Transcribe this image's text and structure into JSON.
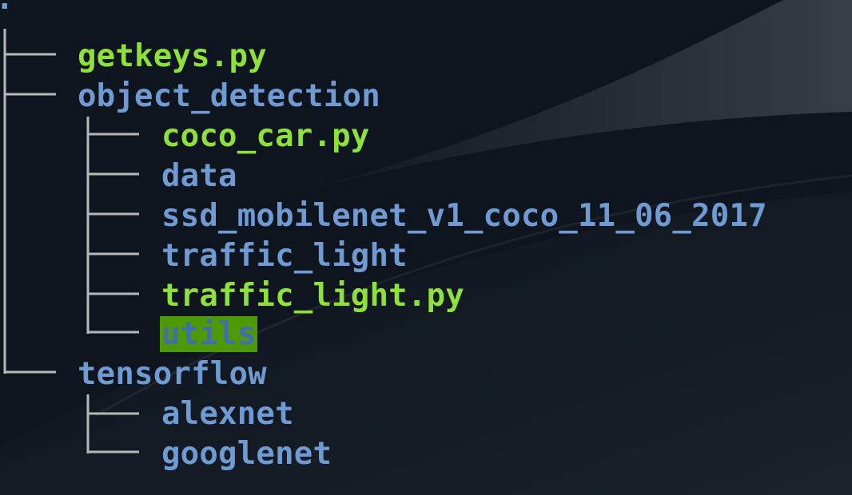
{
  "terminal": {
    "root": ".",
    "colors": {
      "background": "#0e151e",
      "directory": "#6f9ad2",
      "executable": "#8ee03a",
      "highlight_bg": "#4e9a06",
      "tree_lines": "#b8b8b8"
    },
    "tree": [
      {
        "name": "getkeys.py",
        "type": "executable"
      },
      {
        "name": "object_detection",
        "type": "directory"
      },
      {
        "name": "coco_car.py",
        "type": "executable"
      },
      {
        "name": "data",
        "type": "directory"
      },
      {
        "name": "ssd_mobilenet_v1_coco_11_06_2017",
        "type": "directory"
      },
      {
        "name": "traffic_light",
        "type": "directory"
      },
      {
        "name": "traffic_light.py",
        "type": "executable"
      },
      {
        "name": "utils",
        "type": "directory-highlighted"
      },
      {
        "name": "tensorflow",
        "type": "directory"
      },
      {
        "name": "alexnet",
        "type": "directory"
      },
      {
        "name": "googlenet",
        "type": "directory"
      }
    ]
  }
}
